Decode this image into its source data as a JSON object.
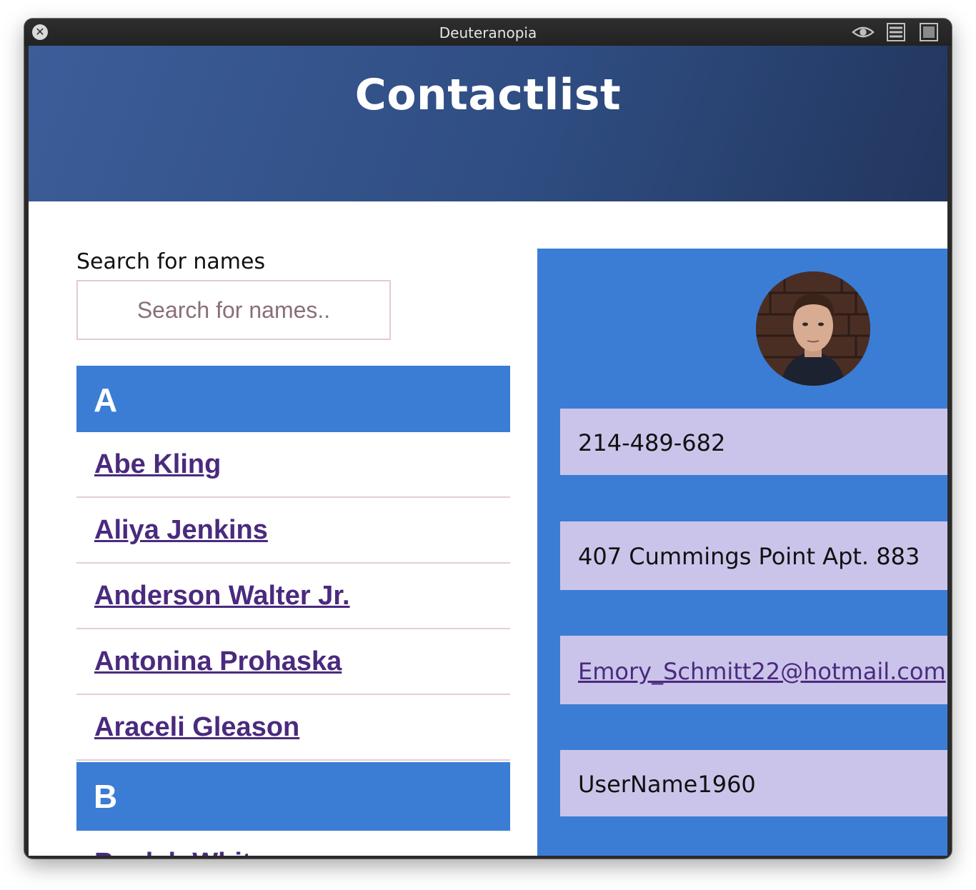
{
  "window": {
    "title": "Deuteranopia",
    "icons": [
      "close-icon",
      "eye-icon",
      "list-view-icon",
      "square-view-icon"
    ]
  },
  "header": {
    "title": "Contactlist"
  },
  "search": {
    "label": "Search for names",
    "placeholder": "Search for names.."
  },
  "groups": [
    {
      "letter": "A",
      "contacts": [
        "Abe Kling",
        "Aliya Jenkins",
        "Anderson Walter Jr.",
        "Antonina Prohaska",
        "Araceli Gleason"
      ]
    },
    {
      "letter": "B",
      "contacts": [
        "Beulah White"
      ]
    }
  ],
  "detail": {
    "phone": "214-489-682",
    "address": "407 Cummings Point Apt. 883",
    "email": "Emory_Schmitt22@hotmail.com",
    "username": "UserName1960"
  },
  "colors": {
    "accent": "#3b7dd4",
    "info_box": "#cbc4ea",
    "link": "#4a2a7e",
    "header_gradient_start": "#3c5d99",
    "header_gradient_end": "#22365e"
  }
}
